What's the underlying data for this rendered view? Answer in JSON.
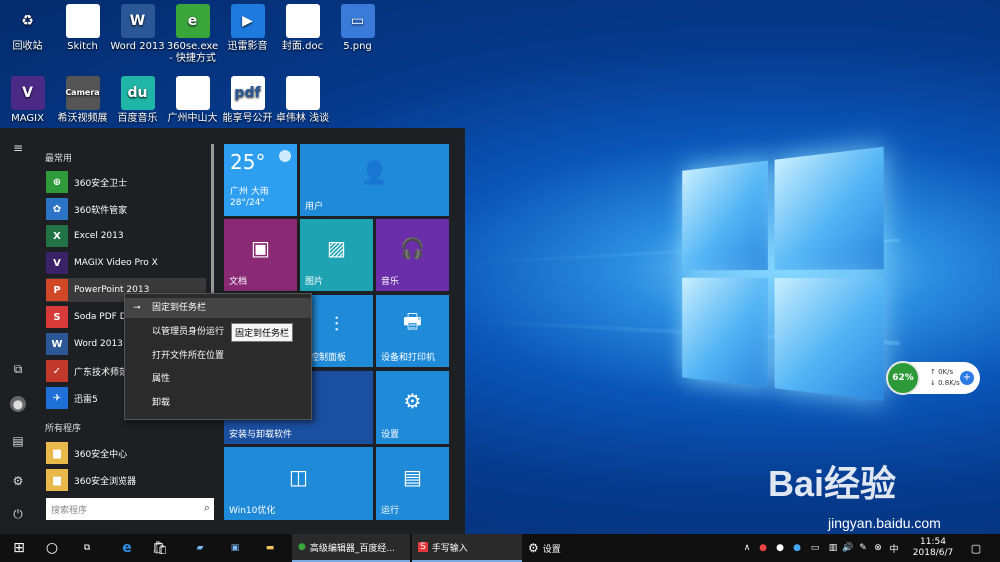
{
  "desktop_icons": [
    {
      "label": "回收站",
      "icon": "recycle-bin-icon",
      "glyph": "♻",
      "bg": "transparent"
    },
    {
      "label": "Skitch",
      "icon": "document-icon",
      "glyph": "",
      "bg": "#fff"
    },
    {
      "label": "Word 2013",
      "icon": "word-icon",
      "glyph": "W",
      "bg": "#2b5797"
    },
    {
      "label": "360se.exe - 快捷方式",
      "icon": "browser-icon",
      "glyph": "e",
      "bg": "#3aa53a"
    },
    {
      "label": "迅雷影音",
      "icon": "xunlei-player-icon",
      "glyph": "▶",
      "bg": "#1f7ae0"
    },
    {
      "label": "封面.doc",
      "icon": "doc-icon",
      "glyph": "",
      "bg": "#fff"
    },
    {
      "label": "5.png",
      "icon": "image-icon",
      "glyph": "▭",
      "bg": "#3a7ad9"
    },
    {
      "label": "MAGIX",
      "icon": "magix-icon",
      "glyph": "V",
      "bg": "#4b2a86"
    },
    {
      "label": "希沃视频展",
      "icon": "camera-icon",
      "glyph": "Camera",
      "bg": "#555"
    },
    {
      "label": "百度音乐",
      "icon": "music-icon",
      "glyph": "du",
      "bg": "#1fb6a8"
    },
    {
      "label": "广州中山大",
      "icon": "document-icon",
      "glyph": "",
      "bg": "#fff"
    },
    {
      "label": "能享号公开",
      "icon": "pdf-icon",
      "glyph": "pdf",
      "bg": "#fff"
    },
    {
      "label": "卓伟林 浅谈",
      "icon": "doc-icon",
      "glyph": "",
      "bg": "#fff"
    }
  ],
  "start_menu": {
    "section_frequent": "最常用",
    "section_all": "所有程序",
    "apps": [
      {
        "label": "360安全卫士",
        "icon": "360-safe-icon",
        "glyph": "⊕",
        "bg": "#2f9a3a"
      },
      {
        "label": "360软件管家",
        "icon": "360-software-icon",
        "glyph": "✿",
        "bg": "#2a73c5"
      },
      {
        "label": "Excel 2013",
        "icon": "excel-icon",
        "glyph": "X",
        "bg": "#217346"
      },
      {
        "label": "MAGIX Video Pro X",
        "icon": "magix-icon",
        "glyph": "V",
        "bg": "#3b2268"
      },
      {
        "label": "PowerPoint 2013",
        "icon": "powerpoint-icon",
        "glyph": "P",
        "bg": "#d24726"
      },
      {
        "label": "Soda PDF D",
        "icon": "soda-pdf-icon",
        "glyph": "S",
        "bg": "#d83a3a"
      },
      {
        "label": "Word 2013",
        "icon": "word-icon",
        "glyph": "W",
        "bg": "#2b5797"
      },
      {
        "label": "广东技术师范",
        "icon": "school-icon",
        "glyph": "✓",
        "bg": "#c0392b"
      },
      {
        "label": "迅雷5",
        "icon": "xunlei-icon",
        "glyph": "✈",
        "bg": "#1e6fd6"
      }
    ],
    "all_apps": [
      {
        "label": "360安全中心",
        "icon": "folder-icon",
        "glyph": "▆",
        "bg": "#e8b84a"
      },
      {
        "label": "360安全浏览器",
        "icon": "folder-icon",
        "glyph": "▆",
        "bg": "#e8b84a"
      }
    ],
    "search_placeholder": "搜索程序"
  },
  "tiles": {
    "weather": {
      "temp": "25°",
      "city": "广州 大雨",
      "range": "28°/24°"
    },
    "user": "用户",
    "documents": "文档",
    "pictures": "图片",
    "music": "音乐",
    "control_panel": "控制面板",
    "devices": "设备和打印机",
    "uninstall": "安装与卸载软件",
    "settings": "设置",
    "win10": "Win10优化",
    "run": "运行"
  },
  "context_menu": {
    "pin_taskbar": "固定到任务栏",
    "run_admin": "以管理员身份运行",
    "open_location": "打开文件所在位置",
    "properties": "属性",
    "uninstall": "卸载"
  },
  "tooltip": "固定到任务栏",
  "net_widget": {
    "percent": "62%",
    "up": "0K/s",
    "down": "0.8K/s"
  },
  "watermark": {
    "brand": "Bai经验",
    "url": "jingyan.baidu.com"
  },
  "taskbar": {
    "app1": "高级编辑器_百度经...",
    "app2": "手写输入",
    "app3": "设置",
    "time": "11:54",
    "date": "2018/6/7"
  }
}
